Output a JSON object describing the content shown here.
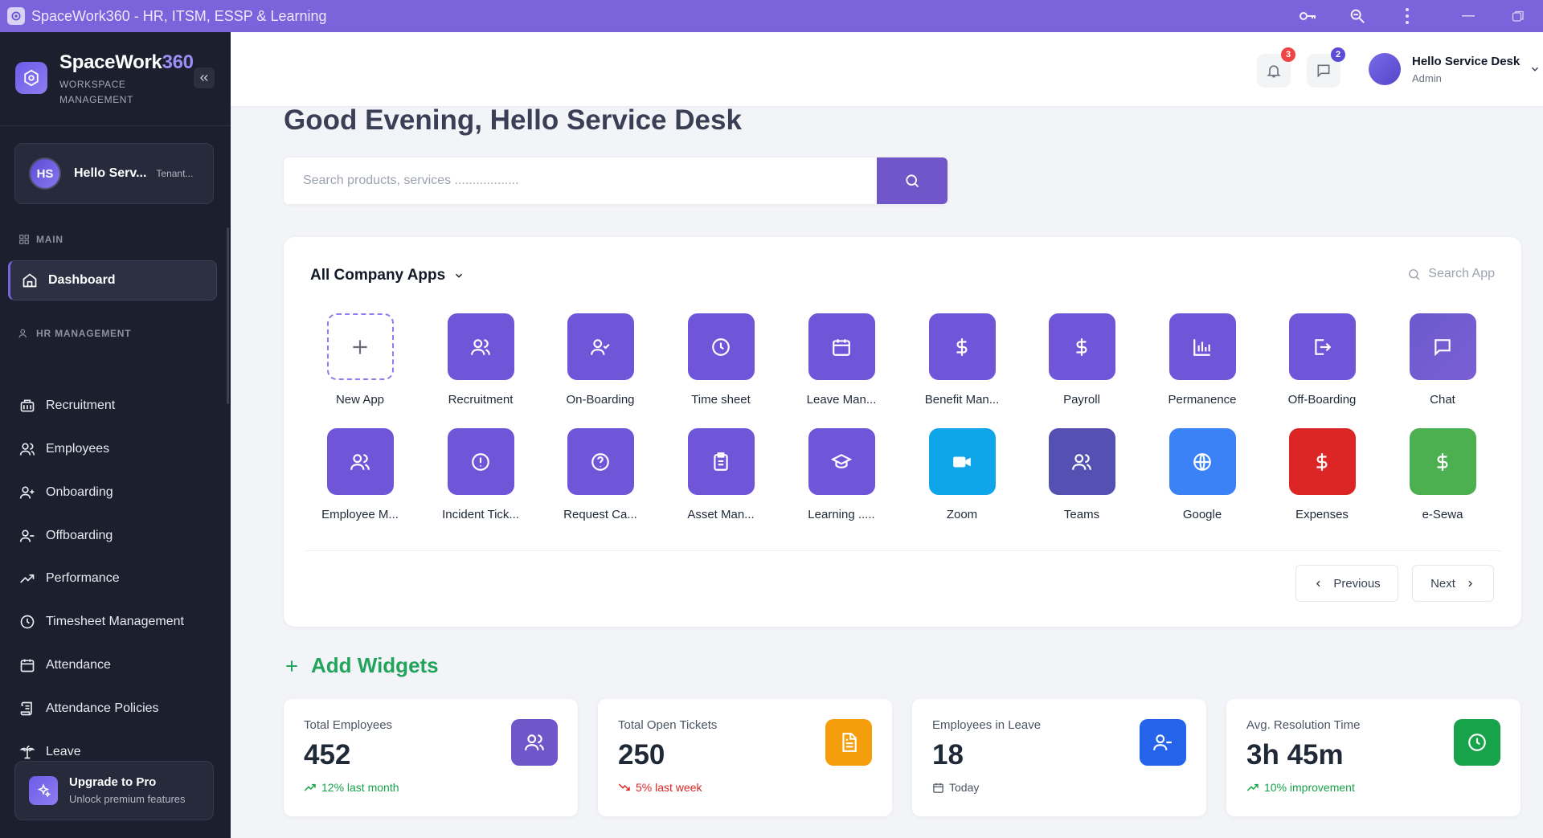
{
  "window": {
    "title": "SpaceWork360 - HR, ITSM, ESSP & Learning",
    "accent": "#7b63db"
  },
  "sidebar": {
    "brand_name": "SpaceWork",
    "brand_num": "360",
    "brand_sub": "WORKSPACE MANAGEMENT",
    "user_initials": "HS",
    "user_name": "Hello Serv...",
    "user_tenant": "Tenant...",
    "section_main": "MAIN",
    "section_hr": "HR MANAGEMENT",
    "items": [
      {
        "label": "Dashboard",
        "icon": "home-icon"
      },
      {
        "label": "Recruitment",
        "icon": "briefcase-icon"
      },
      {
        "label": "Employees",
        "icon": "users-icon"
      },
      {
        "label": "Onboarding",
        "icon": "user-plus-icon"
      },
      {
        "label": "Offboarding",
        "icon": "user-minus-icon"
      },
      {
        "label": "Performance",
        "icon": "trending-up-icon"
      },
      {
        "label": "Timesheet Management",
        "icon": "clock-icon"
      },
      {
        "label": "Attendance",
        "icon": "calendar-icon"
      },
      {
        "label": "Attendance Policies",
        "icon": "scroll-icon"
      },
      {
        "label": "Leave",
        "icon": "palm-tree-icon"
      }
    ],
    "upgrade_title": "Upgrade to Pro",
    "upgrade_sub": "Unlock premium features"
  },
  "header": {
    "notifications_count": "3",
    "messages_count": "2",
    "user_name": "Hello Service Desk",
    "user_role": "Admin"
  },
  "main": {
    "greeting": "Good Evening, Hello Service Desk",
    "search_placeholder": "Search products, services ..................",
    "apps_title": "All Company Apps",
    "app_search_label": "Search App",
    "apps": [
      {
        "label": "New App",
        "icon": "plus-icon",
        "color": "#ffffff"
      },
      {
        "label": "Recruitment",
        "icon": "users-icon",
        "color": "#6f56d9"
      },
      {
        "label": "On-Boarding",
        "icon": "user-check-icon",
        "color": "#6f56d9"
      },
      {
        "label": "Time sheet",
        "icon": "clock-icon",
        "color": "#6f56d9"
      },
      {
        "label": "Leave Man...",
        "icon": "calendar-icon",
        "color": "#6f56d9"
      },
      {
        "label": "Benefit Man...",
        "icon": "dollar-icon",
        "color": "#6f56d9"
      },
      {
        "label": "Payroll",
        "icon": "dollar-icon",
        "color": "#6f56d9"
      },
      {
        "label": "Permanence",
        "icon": "bar-chart-icon",
        "color": "#6f56d9"
      },
      {
        "label": "Off-Boarding",
        "icon": "log-out-icon",
        "color": "#6f56d9"
      },
      {
        "label": "Chat",
        "icon": "message-icon",
        "color": "#6a5acd"
      },
      {
        "label": "Employee M...",
        "icon": "users-icon",
        "color": "#6f56d9"
      },
      {
        "label": "Incident Tick...",
        "icon": "alert-circle-icon",
        "color": "#6f56d9"
      },
      {
        "label": "Request Ca...",
        "icon": "help-circle-icon",
        "color": "#6f56d9"
      },
      {
        "label": "Asset Man...",
        "icon": "clipboard-icon",
        "color": "#6f56d9"
      },
      {
        "label": "Learning .....",
        "icon": "graduation-cap-icon",
        "color": "#6f56d9"
      },
      {
        "label": "Zoom",
        "icon": "video-icon",
        "color": "#0ea5e9"
      },
      {
        "label": "Teams",
        "icon": "users-icon",
        "color": "#5451b3"
      },
      {
        "label": "Google",
        "icon": "globe-icon",
        "color": "#3b82f6"
      },
      {
        "label": "Expenses",
        "icon": "dollar-icon",
        "color": "#dc2626"
      },
      {
        "label": "e-Sewa",
        "icon": "dollar-icon",
        "color": "#4caf50"
      }
    ],
    "prev_label": "Previous",
    "next_label": "Next",
    "add_widgets_label": "Add Widgets"
  },
  "stats": [
    {
      "title": "Total Employees",
      "value": "452",
      "note": "12% last month",
      "trend": "up",
      "icon": "users-icon",
      "color": "#7056c9"
    },
    {
      "title": "Total Open Tickets",
      "value": "250",
      "note": "5% last week",
      "trend": "down",
      "icon": "file-text-icon",
      "color": "#f59e0b"
    },
    {
      "title": "Employees in Leave",
      "value": "18",
      "note": "Today",
      "trend": "calendar",
      "icon": "user-minus-icon",
      "color": "#2563eb"
    },
    {
      "title": "Avg. Resolution Time",
      "value": "3h 45m",
      "note": "10% improvement",
      "trend": "up",
      "icon": "clock-icon",
      "color": "#16a34a"
    }
  ]
}
